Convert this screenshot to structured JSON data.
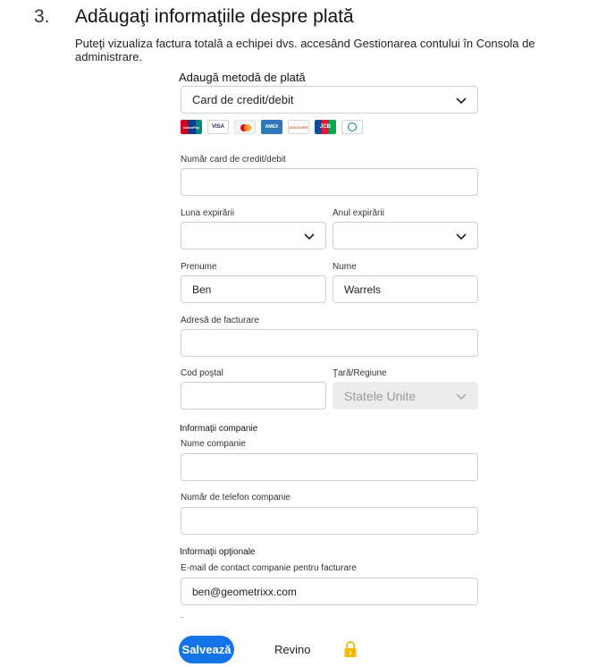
{
  "step": {
    "number": "3.",
    "title": "Adăugaţi informaţiile despre plată",
    "description": "Puteţi vizualiza factura totală a echipei dvs. accesând Gestionarea contului în Consola de administrare."
  },
  "payment_method": {
    "label": "Adaugă metodă de plată",
    "value": "Card de credit/debit",
    "cards": [
      {
        "name": "unionpay-icon",
        "text": "UnionPay"
      },
      {
        "name": "visa-icon",
        "text": "VISA"
      },
      {
        "name": "mastercard-icon",
        "text": ""
      },
      {
        "name": "amex-icon",
        "text": "AMEX"
      },
      {
        "name": "discover-icon",
        "text": "DISCOVER"
      },
      {
        "name": "jcb-icon",
        "text": "JCB"
      },
      {
        "name": "diners-club-icon",
        "text": ""
      }
    ]
  },
  "card_number": {
    "label": "Număr card de credit/debit",
    "value": ""
  },
  "expiry_month": {
    "label": "Luna expirării",
    "value": ""
  },
  "expiry_year": {
    "label": "Anul expirării",
    "value": ""
  },
  "first_name": {
    "label": "Prenume",
    "value": "Ben"
  },
  "last_name": {
    "label": "Nume",
    "value": "Warrels"
  },
  "billing_address": {
    "label": "Adresă de facturare",
    "value": ""
  },
  "postal_code": {
    "label": "Cod poştal",
    "value": ""
  },
  "country": {
    "label": "Ţară/Regiune",
    "value": "Statele Unite"
  },
  "company_section": {
    "heading": "Informaţii companie",
    "name_label": "Nume companie",
    "name_value": "",
    "phone_label": "Număr de telefon companie",
    "phone_value": ""
  },
  "optional_section": {
    "heading": "Informaţii opţionale",
    "email_label": "E-mail de contact companie pentru facturare",
    "email_value": "ben@geometrixx.com"
  },
  "actions": {
    "save_label": "Salvează",
    "back_label": "Revino"
  },
  "colors": {
    "primary": "#1473e6",
    "border": "#cfcfcf",
    "disabled_bg": "#ececec",
    "lock": "#f5b800"
  }
}
